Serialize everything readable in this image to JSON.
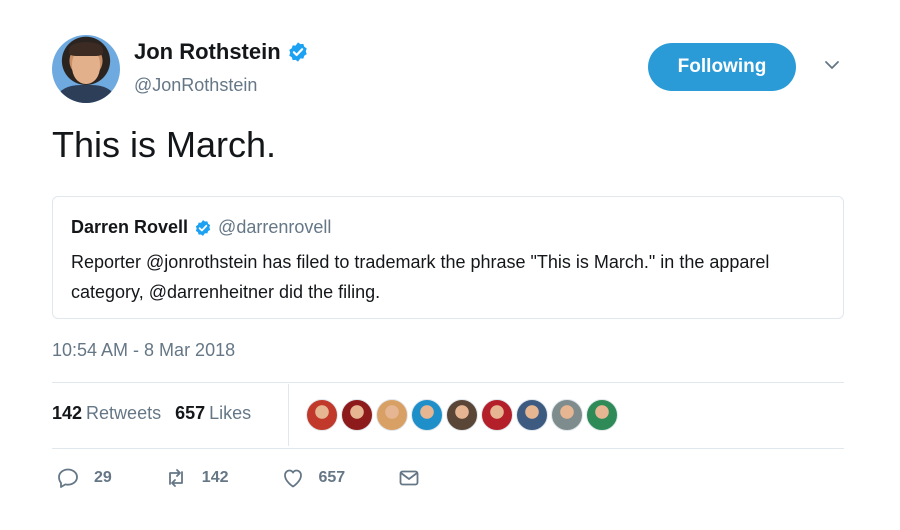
{
  "author": {
    "display_name": "Jon Rothstein",
    "handle": "@JonRothstein",
    "verified_icon": "verified-badge-icon"
  },
  "follow_button": {
    "label": "Following"
  },
  "menu_icon": "chevron-down-icon",
  "tweet": {
    "text": "This is March."
  },
  "quoted_tweet": {
    "display_name": "Darren Rovell",
    "handle": "@darrenrovell",
    "text": "Reporter @jonrothstein has filed to trademark the phrase \"This is March.\" in the apparel category, @darrenheitner did the filing."
  },
  "timestamp": "10:54 AM - 8 Mar 2018",
  "stats": {
    "retweets_count": "142",
    "retweets_label": "Retweets",
    "likes_count": "657",
    "likes_label": "Likes"
  },
  "likers": [
    {
      "color": "#c0392b"
    },
    {
      "color": "#8e1b1b"
    },
    {
      "color": "#d9a066"
    },
    {
      "color": "#1f8fc9"
    },
    {
      "color": "#5a4636"
    },
    {
      "color": "#b3202a"
    },
    {
      "color": "#3d5a80"
    },
    {
      "color": "#7f8c8d"
    },
    {
      "color": "#2e8b57"
    }
  ],
  "actions": {
    "reply_count": "29",
    "retweet_count": "142",
    "like_count": "657"
  },
  "colors": {
    "accent": "#2b9bd8",
    "secondary_text": "#657786",
    "border": "#e1e8ed"
  }
}
